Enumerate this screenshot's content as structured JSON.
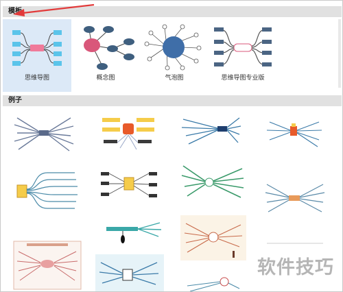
{
  "sections": {
    "templates_title": "模板",
    "examples_title": "例子"
  },
  "templates": [
    {
      "label": "思维导图",
      "icon": "mind-map-icon",
      "selected": true
    },
    {
      "label": "概念图",
      "icon": "concept-map-icon",
      "selected": false
    },
    {
      "label": "气泡图",
      "icon": "bubble-chart-icon",
      "selected": false
    },
    {
      "label": "思维导图专业版",
      "icon": "mind-map-pro-icon",
      "selected": false
    }
  ],
  "watermark": "软件技巧",
  "colors": {
    "selected_bg": "#dce9f7",
    "mind_center": "#f07a9a",
    "mind_nodes": "#5bc4ea",
    "concept_center": "#d9577a",
    "concept_nodes": "#3f5f7f",
    "bubble_center": "#3f6ea8",
    "pro_nodes": "#4b6583",
    "arrow": "#e23a3a"
  }
}
